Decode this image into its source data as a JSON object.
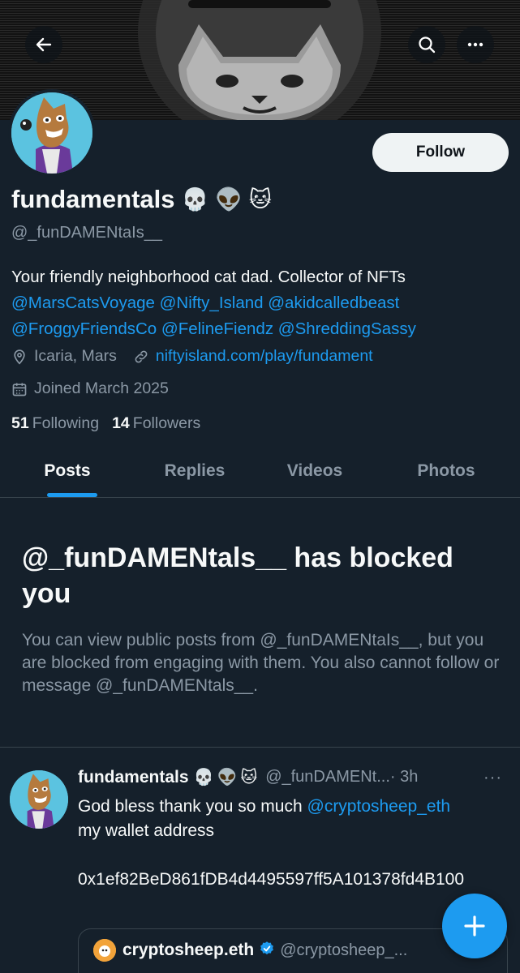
{
  "banner": {
    "icons": [
      "back-arrow-icon",
      "search-icon",
      "more-icon"
    ]
  },
  "profile": {
    "follow_label": "Follow",
    "display_name": "fundamentals",
    "name_emojis": [
      "💀",
      "👽",
      "🐱"
    ],
    "handle": "@_funDAMENtaIs__",
    "bio_text": "Your friendly neighborhood cat dad. Collector of NFTs",
    "bio_mentions": [
      "@MarsCatsVoyage",
      "@Nifty_Island",
      "@akidcalledbeast",
      "@FroggyFriendsCo",
      "@FelineFiendz",
      "@ShreddingSassy"
    ],
    "location": "Icaria, Mars",
    "website": "niftyisland.com/play/fundament",
    "joined": "Joined March 2025",
    "following_count": "51",
    "following_label": "Following",
    "followers_count": "14",
    "followers_label": "Followers"
  },
  "tabs": [
    {
      "label": "Posts",
      "active": true
    },
    {
      "label": "Replies",
      "active": false
    },
    {
      "label": "Videos",
      "active": false
    },
    {
      "label": "Photos",
      "active": false
    }
  ],
  "blocked": {
    "title": "@_funDAMENtals__ has blocked you",
    "description": "You can view public posts from @_funDAMENtaIs__, but you are blocked from engaging with them. You also cannot follow or message @_funDAMENtals__."
  },
  "tweet": {
    "name": "fundamentals",
    "emojis": [
      "💀",
      "👽",
      "🐱"
    ],
    "handle": "@_funDAMENt...",
    "time": "· 3h",
    "more": "···",
    "text_prefix": "God bless thank you so much ",
    "mention": "@cryptosheep_eth",
    "text_line2": "my wallet address",
    "address": "0x1ef82BeD861fDB4d4495597ff5A101378fd4B100"
  },
  "quote": {
    "name": "cryptosheep.eth",
    "handle": "@cryptosheep_...",
    "verified_color": "#1d9bf0"
  },
  "colors": {
    "accent": "#1d9bf0",
    "background": "#15202b",
    "muted": "#8b98a5"
  }
}
